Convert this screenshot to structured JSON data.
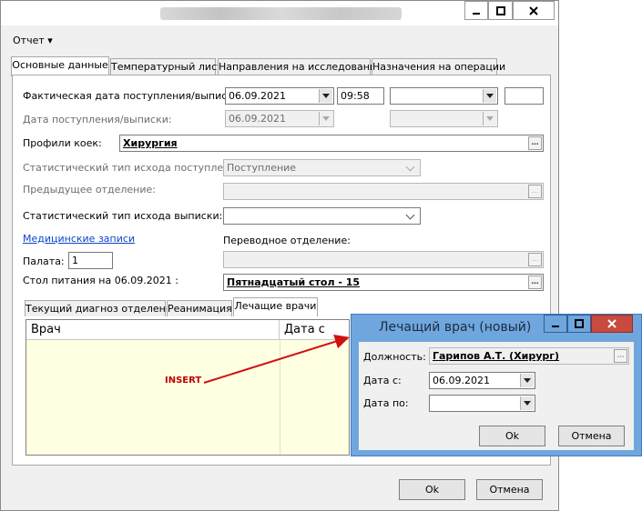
{
  "menu": {
    "report": "Отчет ▾"
  },
  "tabs": [
    "Основные данные",
    "Температурный лист",
    "Направления на исследования",
    "Назначения на операции"
  ],
  "form": {
    "actual_date_label": "Фактическая дата поступления/выписки:",
    "actual_date": "06.09.2021",
    "actual_time": "09:58",
    "admission_date_label": "Дата поступления/выписки:",
    "admission_date": "06.09.2021",
    "bed_profile_label": "Профили коек:",
    "bed_profile": "Хирургия",
    "stat_admission_label": "Статистический тип исхода поступления:",
    "stat_admission_value": "Поступление",
    "prev_dept_label": "Предыдущее отделение:",
    "stat_discharge_label": "Статистический тип исхода выписки:",
    "medical_records_link": "Медицинские записи",
    "transfer_dept_label": "Переводное отделение:",
    "ward_label": "Палата:",
    "ward_value": "1",
    "diet_label": "Стол питания на 06.09.2021 :",
    "diet_value": "Пятнадцатый стол - 15"
  },
  "subtabs": [
    "Текущий диагноз отделения",
    "Реанимация",
    "Лечащие врачи"
  ],
  "grid": {
    "columns": [
      "Врач",
      "Дата с"
    ]
  },
  "annotation": {
    "insert": "INSERT"
  },
  "footer": {
    "ok": "Ok",
    "cancel": "Отмена"
  },
  "dialog": {
    "title": "Лечащий врач (новый)",
    "position_label": "Должность:",
    "position_value": "Гарипов А.Т. (Хирург)",
    "date_from_label": "Дата с:",
    "date_from": "06.09.2021",
    "date_to_label": "Дата по:",
    "ok": "Ok",
    "cancel": "Отмена"
  },
  "colors": {
    "dialog_frame": "#6fa6dd",
    "close_red": "#c94a3e",
    "grid_bg": "#ffffe1",
    "link": "#0b45c8",
    "annotation": "#c00000"
  }
}
